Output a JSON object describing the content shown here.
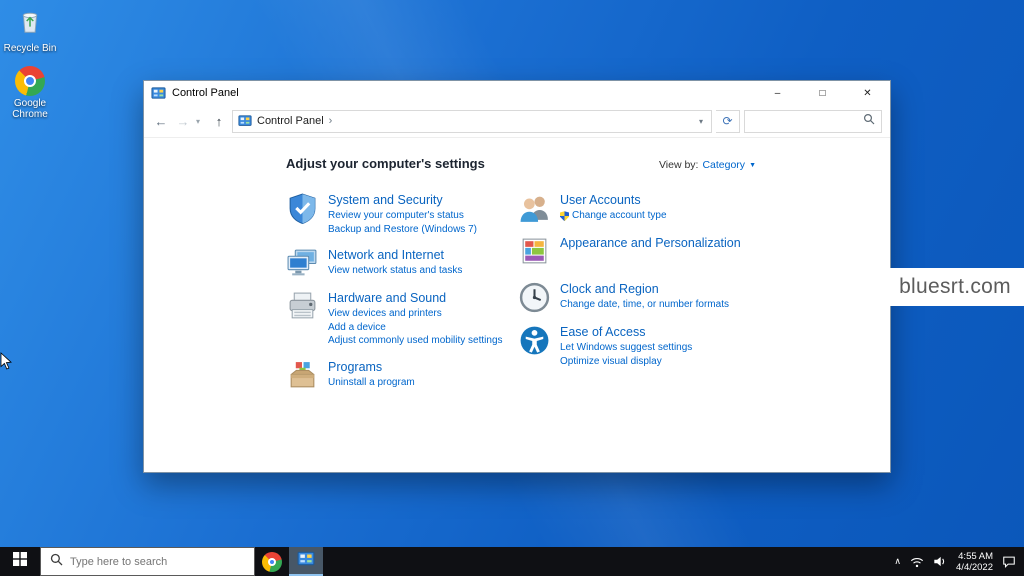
{
  "icons": {
    "back": "←",
    "forward": "→",
    "up": "↑",
    "caret": "▾",
    "small_caret": "▼",
    "chevron_right": "›",
    "refresh": "⟳",
    "minimize": "–",
    "maximize": "□",
    "close": "✕",
    "tray_chevron": "∧"
  },
  "desktop": {
    "icons": [
      {
        "label": "Recycle Bin"
      },
      {
        "label": "Google Chrome"
      }
    ],
    "watermark": "bluesrt.com"
  },
  "window": {
    "title": "Control Panel",
    "nav": {
      "breadcrumb_root": "Control Panel",
      "search_placeholder": ""
    },
    "heading": "Adjust your computer's settings",
    "view_by": {
      "label": "View by:",
      "value": "Category"
    },
    "columns": {
      "left": [
        {
          "title": "System and Security",
          "links": [
            "Review your computer's status",
            "Backup and Restore (Windows 7)"
          ]
        },
        {
          "title": "Network and Internet",
          "links": [
            "View network status and tasks"
          ]
        },
        {
          "title": "Hardware and Sound",
          "links": [
            "View devices and printers",
            "Add a device",
            "Adjust commonly used mobility settings"
          ]
        },
        {
          "title": "Programs",
          "links": [
            "Uninstall a program"
          ]
        }
      ],
      "right": [
        {
          "title": "User Accounts",
          "links": [
            "Change account type"
          ]
        },
        {
          "title": "Appearance and Personalization",
          "links": []
        },
        {
          "title": "Clock and Region",
          "links": [
            "Change date, time, or number formats"
          ]
        },
        {
          "title": "Ease of Access",
          "links": [
            "Let Windows suggest settings",
            "Optimize visual display"
          ]
        }
      ]
    }
  },
  "taskbar": {
    "search_placeholder": "Type here to search",
    "clock": {
      "time": "4:55 AM",
      "date": "4/4/2022"
    }
  },
  "colors": {
    "link_blue": "#0066cc",
    "category_title_blue": "#0a64c0",
    "taskbar_bg": "#0f1014",
    "desktop_blue": "#1265c8"
  }
}
